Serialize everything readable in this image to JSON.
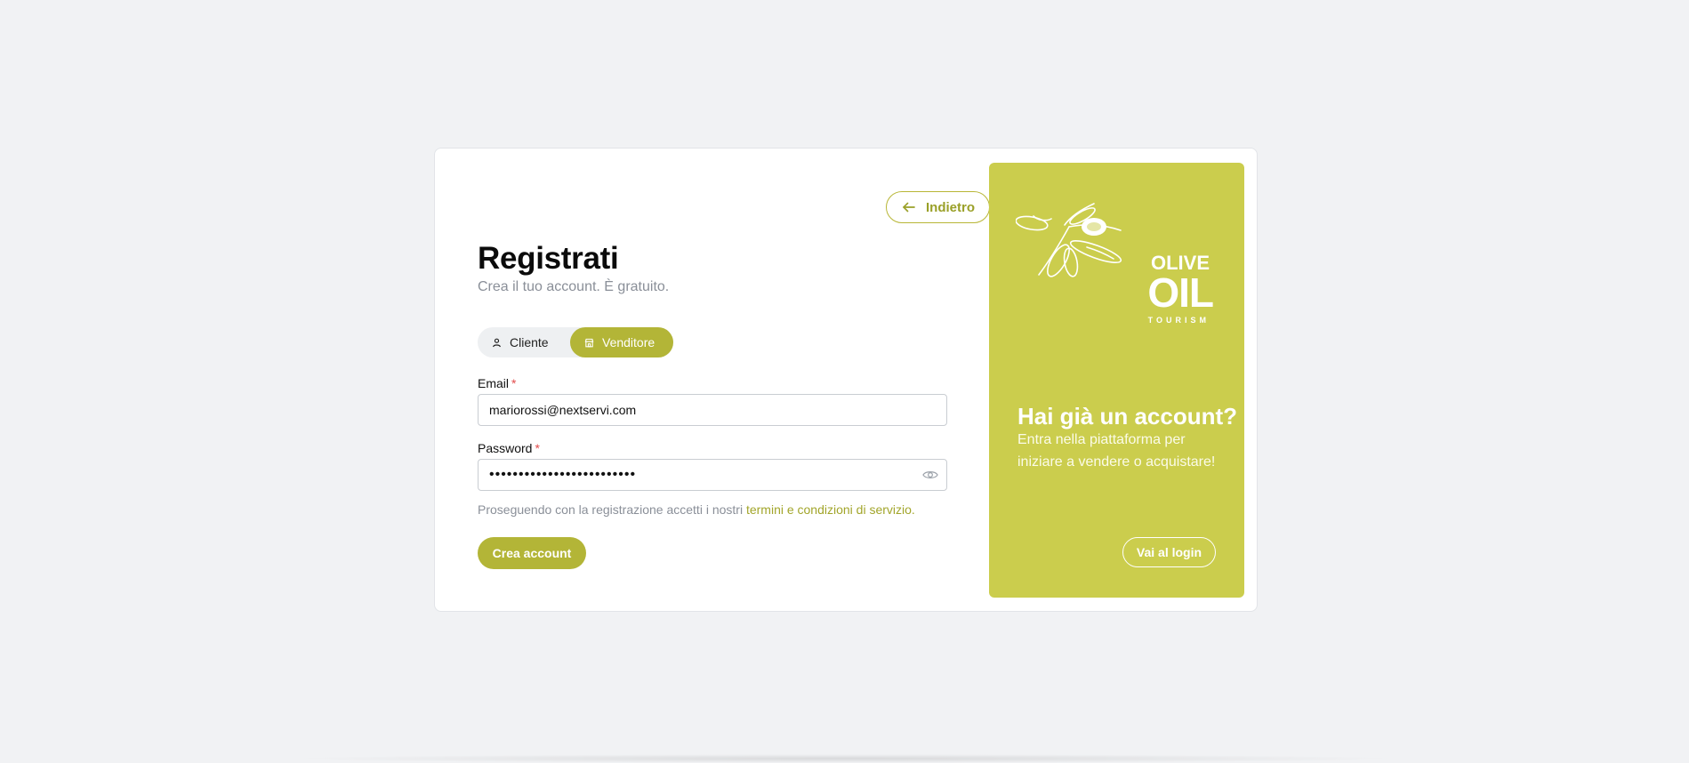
{
  "back_button": {
    "label": "Indietro"
  },
  "form": {
    "title": "Registrati",
    "subtitle": "Crea il tuo account. È gratuito.",
    "roles": {
      "client": "Cliente",
      "seller": "Venditore",
      "selected": "Venditore"
    },
    "email": {
      "label": "Email",
      "required_mark": "*",
      "value": "mariorossi@nextservi.com"
    },
    "password": {
      "label": "Password",
      "required_mark": "*",
      "value": "•••••••••••••••••••••••••"
    },
    "terms_text": "Proseguendo con la registrazione accetti i nostri",
    "terms_link": "termini e condizioni di servizio.",
    "submit_label": "Crea account"
  },
  "side_panel": {
    "logo": {
      "line1": "OLIVE",
      "line2": "OIL",
      "line3": "TOURISM"
    },
    "title": "Hai già un account?",
    "text": "Entra nella piattaforma per iniziare a vendere o acquistare!",
    "login_label": "Vai al login"
  },
  "colors": {
    "accent": "#b3b537",
    "panel": "#cbcd4d",
    "background": "#f1f2f4",
    "required": "#e24c4c"
  }
}
